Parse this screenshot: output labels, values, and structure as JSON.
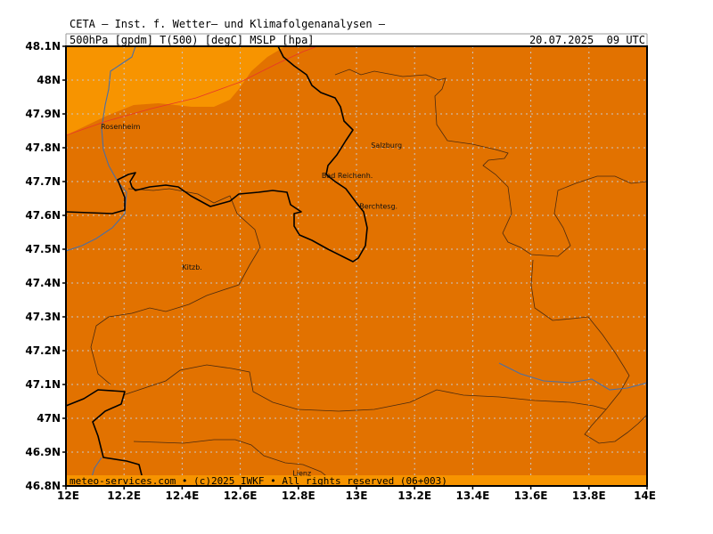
{
  "header": {
    "title": "CETA — Inst. f. Wetter— und Klimafolgenanalysen —",
    "params": "500hPa [gpdm] T(500) [degC] MSLP [hpa]",
    "valid": "20.07.2025  09 UTC"
  },
  "footer": {
    "credit": "meteo-services.com • (c)2025 IWKF • All rights reserved (06+003)"
  },
  "axes": {
    "lat_labels": [
      "48.1N",
      "48N",
      "47.9N",
      "47.8N",
      "47.7N",
      "47.6N",
      "47.5N",
      "47.4N",
      "47.3N",
      "47.2N",
      "47.1N",
      "47N",
      "46.9N",
      "46.8N"
    ],
    "lon_labels": [
      "12E",
      "12.2E",
      "12.4E",
      "12.6E",
      "12.8E",
      "13E",
      "13.2E",
      "13.4E",
      "13.6E",
      "13.8E",
      "14E"
    ]
  },
  "cities": [
    {
      "name": "Rosenheim",
      "lat": 47.855,
      "lon": 12.12
    },
    {
      "name": "Salzburg",
      "lat": 47.8,
      "lon": 13.05
    },
    {
      "name": "Bad Reichenh.",
      "lat": 47.71,
      "lon": 12.88
    },
    {
      "name": "Berchtesg.",
      "lat": 47.62,
      "lon": 13.01
    },
    {
      "name": "Kitzb.",
      "lat": 47.44,
      "lon": 12.4
    },
    {
      "name": "Lienz",
      "lat": 46.83,
      "lon": 12.78
    }
  ],
  "colors": {
    "field_main": "#e27200",
    "field_warm": "#f79400",
    "border": "#000000",
    "river": "#4a6fa5",
    "topo": "#4a2a10",
    "grid": "#c8c8c8"
  }
}
